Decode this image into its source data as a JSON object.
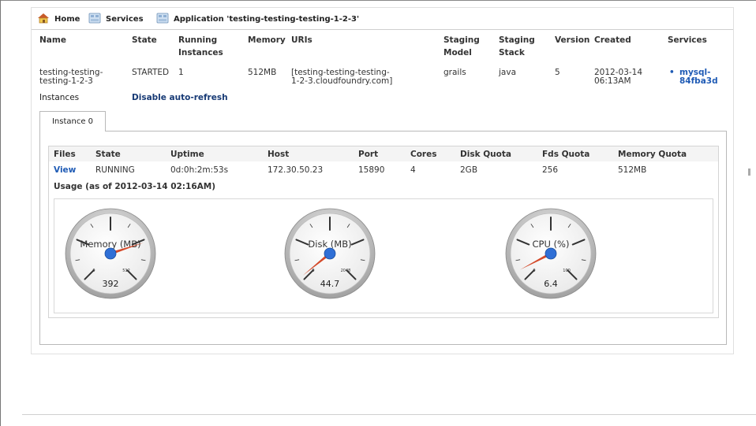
{
  "breadcrumb": {
    "home": "Home",
    "services": "Services",
    "application": "Application 'testing-testing-testing-1-2-3'"
  },
  "app_table": {
    "headers": {
      "name": "Name",
      "state": "State",
      "running_1": "Running",
      "running_2": "Instances",
      "memory": "Memory",
      "uris": "URIs",
      "staging_model_1": "Staging",
      "staging_model_2": "Model",
      "staging_stack_1": "Staging",
      "staging_stack_2": "Stack",
      "version": "Version",
      "created": "Created",
      "services": "Services"
    },
    "row": {
      "name_1": "testing-testing-",
      "name_2": "testing-1-2-3",
      "state": "STARTED",
      "running": "1",
      "memory": "512MB",
      "uri_1": "[testing-testing-testing-",
      "uri_2": "1-2-3.cloudfoundry.com]",
      "staging_model": "grails",
      "staging_stack": "java",
      "version": "5",
      "created_1": "2012-03-14",
      "created_2": "06:13AM",
      "service_bullet": "•",
      "service_1": "mysql-",
      "service_2": "84fba3d"
    }
  },
  "instances": {
    "label": "Instances",
    "auto_refresh": "Disable auto-refresh",
    "tab": "Instance 0",
    "headers": {
      "files": "Files",
      "state": "State",
      "uptime": "Uptime",
      "host": "Host",
      "port": "Port",
      "cores": "Cores",
      "disk_quota": "Disk Quota",
      "fds_quota": "Fds Quota",
      "memory_quota": "Memory Quota"
    },
    "row": {
      "files": "View",
      "state": "RUNNING",
      "uptime": "0d:0h:2m:53s",
      "host": "172.30.50.23",
      "port": "15890",
      "cores": "4",
      "disk_quota": "2GB",
      "fds_quota": "256",
      "memory_quota": "512MB"
    },
    "usage": "Usage (as of 2012-03-14 02:16AM)"
  },
  "gauges": [
    {
      "label": "Memory (MB)",
      "value": 392,
      "min_label": "0",
      "max_label": "512",
      "display": "392",
      "fraction": 0.7656
    },
    {
      "label": "Disk (MB)",
      "value": 44.7,
      "min_label": "0",
      "max_label": "2048",
      "display": "44.7",
      "fraction": 0.0218
    },
    {
      "label": "CPU (%)",
      "value": 6.4,
      "min_label": "0",
      "max_label": "100",
      "display": "6.4",
      "fraction": 0.064
    }
  ],
  "colors": {
    "link": "#1f5bb5",
    "needle": "#d44a2a",
    "hub": "#2f6fd6"
  },
  "icons": {
    "home": "home-icon",
    "services": "services-icon",
    "application": "application-icon"
  }
}
